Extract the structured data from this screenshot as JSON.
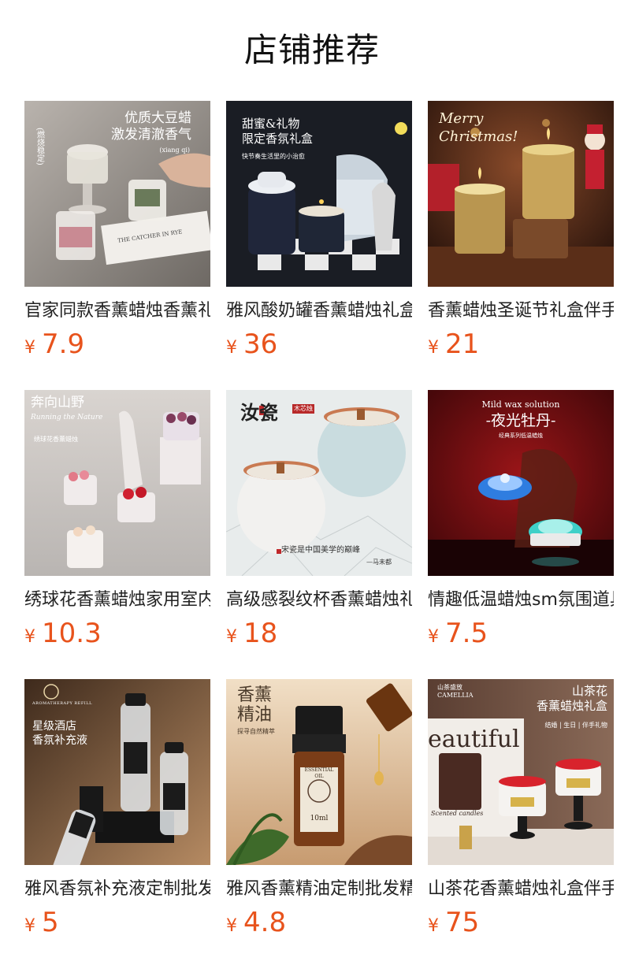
{
  "page": {
    "title": "店铺推荐"
  },
  "currency": "¥",
  "products": [
    {
      "name": "官家同款香薰蜡烛香薰礼盒",
      "price": "7.9",
      "overlay": {
        "main": "优质大豆蜡\n激发清澈香气",
        "side": "(燃烧稳定)",
        "small": "(xiang qi)",
        "book": "THE CATCHER IN RYE"
      }
    },
    {
      "name": "雅风酸奶罐香薰蜡烛礼盒",
      "price": "36",
      "overlay": {
        "main": "甜蜜&礼物\n限定香氛礼盒",
        "small": "快节奏生活里的小治愈"
      }
    },
    {
      "name": "香薰蜡烛圣诞节礼盒伴手礼",
      "price": "21",
      "overlay": {
        "main": "Merry\nChristmas!"
      }
    },
    {
      "name": "绣球花香薰蜡烛家用室内",
      "price": "10.3",
      "overlay": {
        "main": "奔向山野",
        "script": "Running the Nature",
        "small": "绣球花香薰蜡烛"
      }
    },
    {
      "name": "高级感裂纹杯香薰蜡烛礼物",
      "price": "18",
      "overlay": {
        "main": "汝瓷",
        "seal": "木芯烛",
        "bottom": "宋瓷是中国美学的巅峰",
        "sig": "—马未都"
      }
    },
    {
      "name": "情趣低温蜡烛sm氛围道具",
      "price": "7.5",
      "overlay": {
        "top": "Mild wax solution",
        "main": "-夜光牡丹-",
        "small": "经典系列低温蜡烛"
      }
    },
    {
      "name": "雅风香氛补充液定制批发",
      "price": "5",
      "overlay": {
        "brand": "AROMATHERAPY REFILL",
        "main": "星级酒店\n香氛补充液"
      }
    },
    {
      "name": "雅风香薰精油定制批发精油",
      "price": "4.8",
      "overlay": {
        "main": "香薰\n精油",
        "small": "探寻自然精萃",
        "label": "ESSENTIAL OIL",
        "vol": "10ml"
      }
    },
    {
      "name": "山茶花香薰蜡烛礼盒伴手礼",
      "price": "75",
      "overlay": {
        "top": "山茶盛放\nCAMELLIA",
        "main": "山茶花\n香薰蜡烛礼盒",
        "small": "结婚 | 生日 | 伴手礼物",
        "box": "eautiful",
        "box2": "Scented candles"
      }
    }
  ]
}
